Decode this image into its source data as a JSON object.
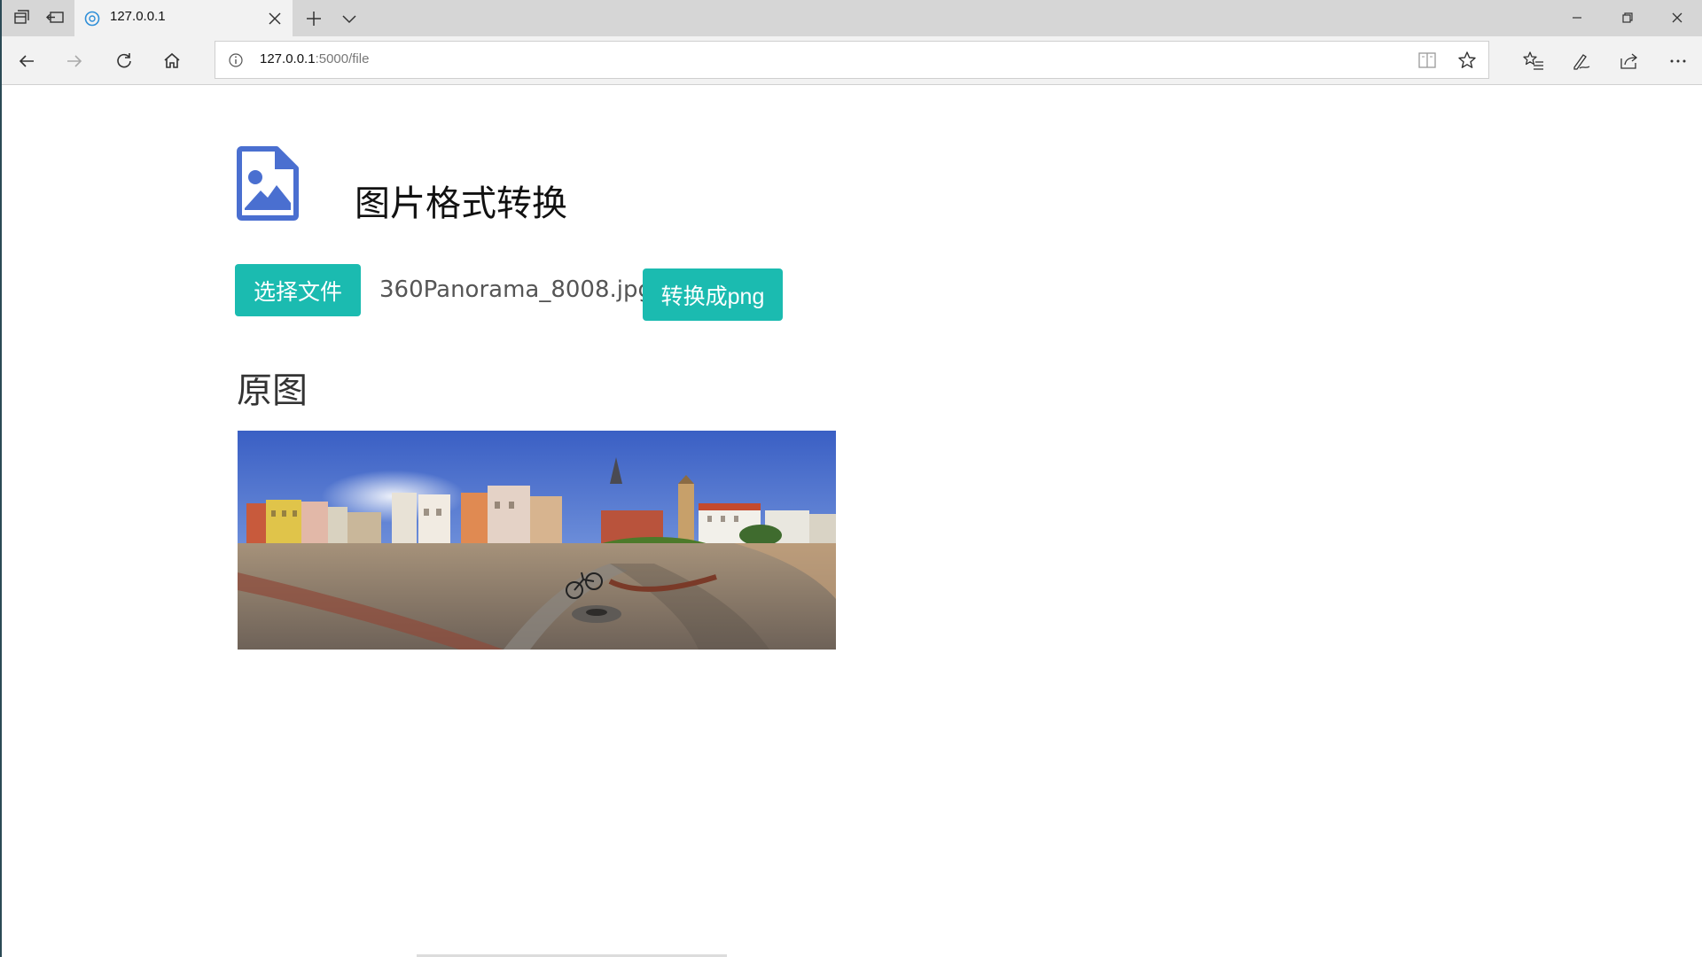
{
  "browser": {
    "tab": {
      "title": "127.0.0.1"
    },
    "address": {
      "host": "127.0.0.1",
      "rest": ":5000/file"
    }
  },
  "page": {
    "title": "图片格式转换",
    "choose_button": "选择文件",
    "file_name": "360Panorama_8008.jpg",
    "convert_button": "转换成png",
    "original_label": "原图"
  },
  "colors": {
    "accent": "#1bbbb0",
    "icon_blue": "#4a6fd0"
  }
}
